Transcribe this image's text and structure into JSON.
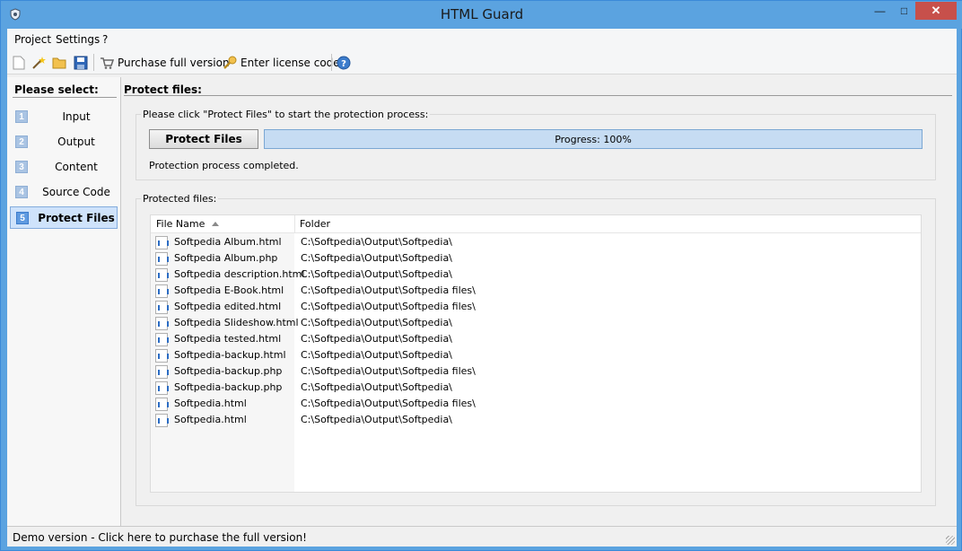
{
  "window": {
    "title": "HTML Guard"
  },
  "menu": {
    "items": [
      "Project",
      "Settings",
      "?"
    ]
  },
  "toolbar": {
    "purchase_label": "Purchase full version",
    "license_label": "Enter license code"
  },
  "sidebar": {
    "heading": "Please select:",
    "items": [
      {
        "num": "1",
        "label": "Input"
      },
      {
        "num": "2",
        "label": "Output"
      },
      {
        "num": "3",
        "label": "Content"
      },
      {
        "num": "4",
        "label": "Source Code"
      },
      {
        "num": "5",
        "label": "Protect Files",
        "active": true
      }
    ]
  },
  "main": {
    "title": "Protect files:",
    "instruction_group": "Please click \"Protect Files\" to start the protection process:",
    "protect_button": "Protect Files",
    "progress": {
      "label": "Progress: 100%",
      "fraction": 1.0
    },
    "status": "Protection process completed.",
    "files_group": "Protected files:",
    "columns": [
      "File Name",
      "Folder"
    ],
    "rows": [
      {
        "name": "Softpedia Album.html",
        "folder": "C:\\Softpedia\\Output\\Softpedia\\"
      },
      {
        "name": "Softpedia Album.php",
        "folder": "C:\\Softpedia\\Output\\Softpedia\\"
      },
      {
        "name": "Softpedia description.html",
        "folder": "C:\\Softpedia\\Output\\Softpedia\\"
      },
      {
        "name": "Softpedia E-Book.html",
        "folder": "C:\\Softpedia\\Output\\Softpedia files\\"
      },
      {
        "name": "Softpedia edited.html",
        "folder": "C:\\Softpedia\\Output\\Softpedia files\\"
      },
      {
        "name": "Softpedia Slideshow.html",
        "folder": "C:\\Softpedia\\Output\\Softpedia\\"
      },
      {
        "name": "Softpedia tested.html",
        "folder": "C:\\Softpedia\\Output\\Softpedia\\"
      },
      {
        "name": "Softpedia-backup.html",
        "folder": "C:\\Softpedia\\Output\\Softpedia\\"
      },
      {
        "name": "Softpedia-backup.php",
        "folder": "C:\\Softpedia\\Output\\Softpedia files\\"
      },
      {
        "name": "Softpedia-backup.php",
        "folder": "C:\\Softpedia\\Output\\Softpedia\\"
      },
      {
        "name": "Softpedia.html",
        "folder": "C:\\Softpedia\\Output\\Softpedia files\\"
      },
      {
        "name": "Softpedia.html",
        "folder": "C:\\Softpedia\\Output\\Softpedia\\"
      }
    ]
  },
  "statusbar": {
    "text": "Demo version - Click here to purchase the full version!"
  },
  "colors": {
    "titlebar": "#5ba3e0",
    "close_button": "#c7504b",
    "active_nav": "#cfe3fb",
    "progress": "#cbe0f5"
  }
}
